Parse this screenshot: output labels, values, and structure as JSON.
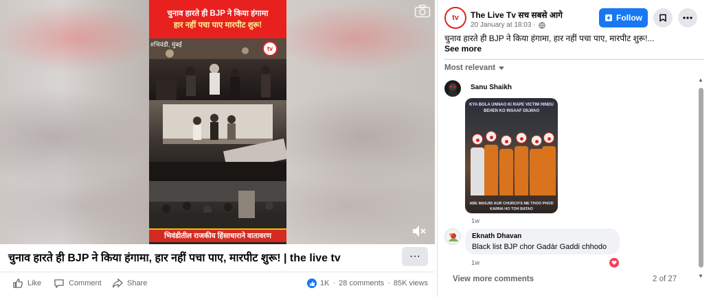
{
  "video": {
    "banner_line1": "चुनाव हारते ही BJP ने किया हंगामा",
    "banner_line2": "हार नहीं पचा पाए मारपीट शुरू!",
    "location_tag": "#भिवंडी, मुंबई",
    "channel_badge": "tv",
    "bottom_caption": "भिवंडीतील राजकीय हिंसाचाराने वातावरण",
    "camera_icon": "camera-icon",
    "mute_icon": "speaker-muted-icon"
  },
  "post_footer": {
    "title": "चुनाव हारते ही BJP ने किया हंगामा, हार नहीं पचा पाए, मारपीट शुरू! | the live tv",
    "more_label": "···",
    "like_label": "Like",
    "comment_label": "Comment",
    "share_label": "Share",
    "reactions": "1K",
    "comments": "28 comments",
    "views": "85K views"
  },
  "post": {
    "page_name": "The Live Tv सच सबसे आगे",
    "avatar_text": "tv",
    "date": "20 January at 18:03 ·",
    "follow_label": "Follow",
    "text": "चुनाव हारते ही BJP ने किया हंगामा, हार नहीं पचा पाए, मारपीट शुरू!...",
    "see_more": "See more",
    "sort_label": "Most relevant"
  },
  "comments": [
    {
      "name": "Sanu Shaikh",
      "image_top": "KYA BOLA UNNAO KI RAPE VICTIM HINDU BEHEN KO INSAAF DILWAO",
      "image_bottom": "ABE MASJID AUR CHURCH'S ME THOO PHOD KARNA HO TOH BATAO",
      "time": "1w"
    },
    {
      "name": "Eknath Dhavan",
      "text": "Black list BJP chor Gadàr Gaddi chhodo",
      "time": "1w"
    }
  ],
  "footer": {
    "view_more": "View more comments",
    "page_count": "2 of 27"
  },
  "colors": {
    "brand_blue": "#1877f2",
    "red_banner": "#e8211f",
    "heart": "#f33e58"
  }
}
